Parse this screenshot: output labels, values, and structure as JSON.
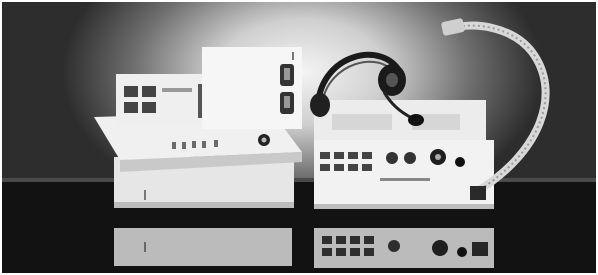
{
  "scene": {
    "subject": "photograph-of-audio-intercom-equipment",
    "colors": {
      "backdrop": "#2d2d2d",
      "glow": "#f4f4f4",
      "table": "#141414",
      "equipment": "#e9e9e9"
    }
  }
}
